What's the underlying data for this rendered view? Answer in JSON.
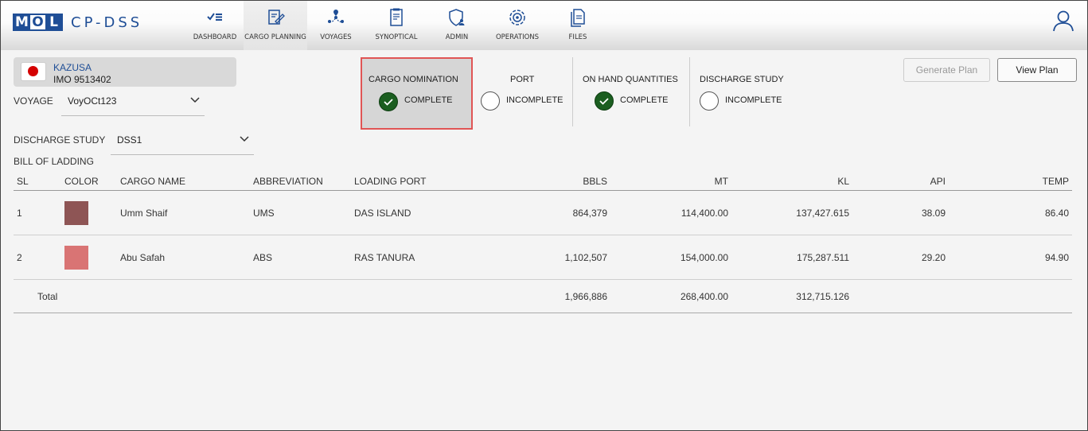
{
  "app": {
    "logo_letters": [
      "M",
      "O",
      "L"
    ],
    "title": "CP-DSS"
  },
  "nav": [
    {
      "label": "DASHBOARD",
      "icon": "dashboard-icon"
    },
    {
      "label": "CARGO PLANNING",
      "icon": "cargo-planning-icon",
      "active": true
    },
    {
      "label": "VOYAGES",
      "icon": "voyages-icon"
    },
    {
      "label": "SYNOPTICAL",
      "icon": "synoptical-icon"
    },
    {
      "label": "ADMIN",
      "icon": "admin-icon"
    },
    {
      "label": "OPERATIONS",
      "icon": "operations-icon"
    },
    {
      "label": "FILES",
      "icon": "files-icon"
    }
  ],
  "vessel": {
    "name": "KAZUSA",
    "imo": "IMO 9513402",
    "flag": "japan"
  },
  "voyage": {
    "label": "VOYAGE",
    "value": "VoyOCt123"
  },
  "discharge_study_select": {
    "label": "DISCHARGE STUDY",
    "value": "DSS1"
  },
  "steps": [
    {
      "title": "CARGO NOMINATION",
      "status": "COMPLETE",
      "done": true
    },
    {
      "title": "PORT",
      "status": "INCOMPLETE",
      "done": false
    },
    {
      "title": "ON HAND QUANTITIES",
      "status": "COMPLETE",
      "done": true
    },
    {
      "title": "DISCHARGE STUDY",
      "status": "INCOMPLETE",
      "done": false
    }
  ],
  "buttons": {
    "generate_plan": "Generate Plan",
    "view_plan": "View Plan"
  },
  "section_title": "BILL OF LADDING",
  "table": {
    "headers": {
      "sl": "SL",
      "color": "COLOR",
      "cargo_name": "CARGO NAME",
      "abbreviation": "ABBREVIATION",
      "loading_port": "LOADING PORT",
      "bbls": "BBLS",
      "mt": "MT",
      "kl": "KL",
      "api": "API",
      "temp": "TEMP"
    },
    "rows": [
      {
        "sl": "1",
        "color": "#8e5555",
        "cargo_name": "Umm Shaif",
        "abbreviation": "UMS",
        "loading_port": "DAS ISLAND",
        "bbls": "864,379",
        "mt": "114,400.00",
        "kl": "137,427.615",
        "api": "38.09",
        "temp": "86.40"
      },
      {
        "sl": "2",
        "color": "#d97474",
        "cargo_name": "Abu Safah",
        "abbreviation": "ABS",
        "loading_port": "RAS TANURA",
        "bbls": "1,102,507",
        "mt": "154,000.00",
        "kl": "175,287.511",
        "api": "29.20",
        "temp": "94.90"
      }
    ],
    "total": {
      "label": "Total",
      "bbls": "1,966,886",
      "mt": "268,400.00",
      "kl": "312,715.126"
    }
  },
  "colors": {
    "brand": "#1f4e96",
    "complete": "#1b5e20",
    "highlight": "#e05555"
  }
}
